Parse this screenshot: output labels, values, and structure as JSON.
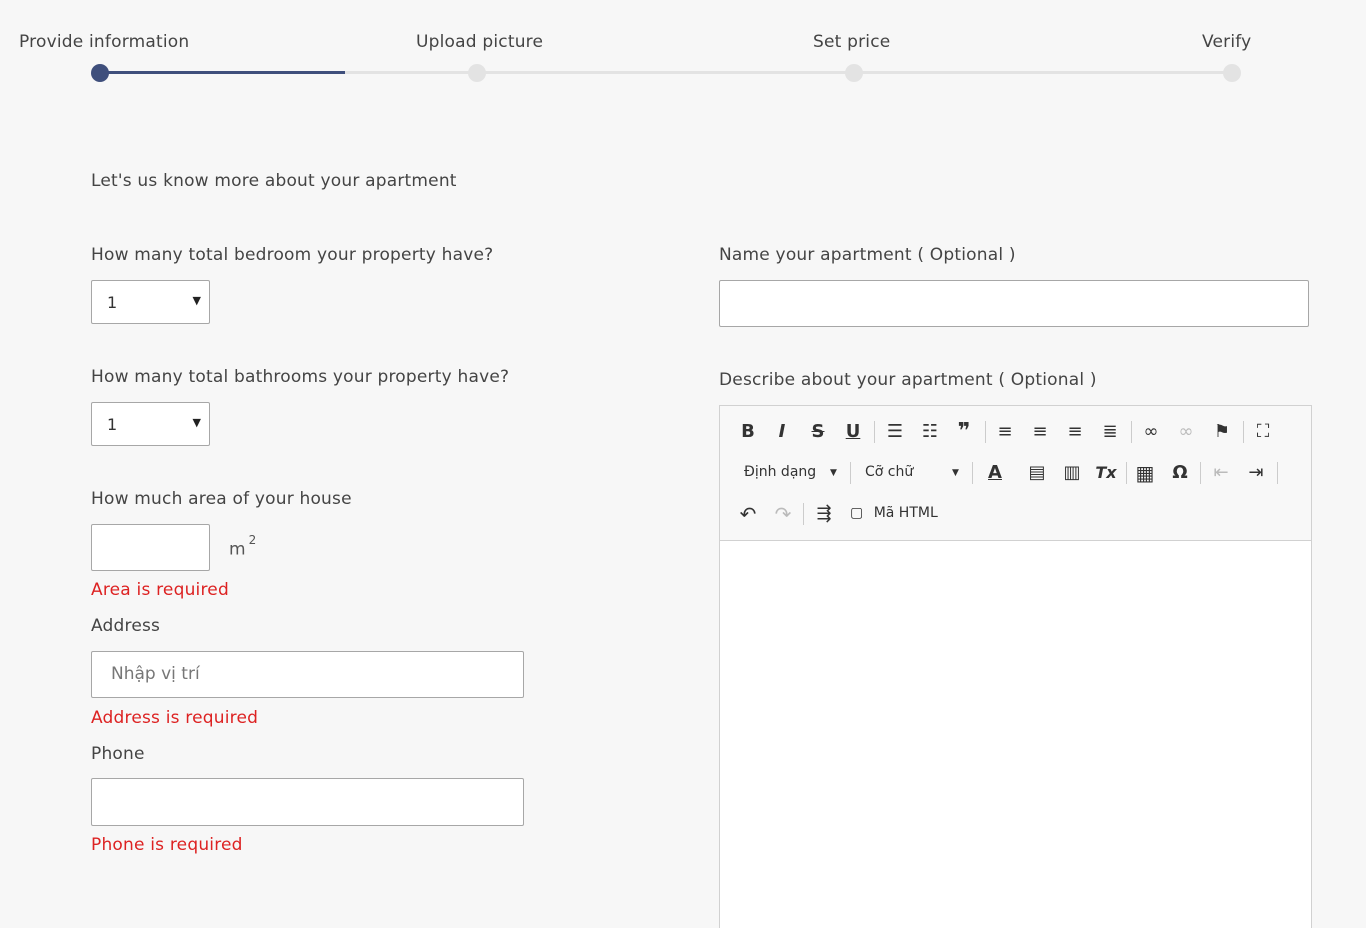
{
  "stepper": {
    "steps": [
      "Provide information",
      "Upload picture",
      "Set price",
      "Verify"
    ]
  },
  "form": {
    "intro": "Let's us know more about your apartment",
    "bedrooms": {
      "label": "How many total bedroom your property have?",
      "value": "1"
    },
    "bathrooms": {
      "label": "How many total bathrooms your property have?",
      "value": "1"
    },
    "area": {
      "label": "How much area of your house",
      "value": "",
      "unit": "m",
      "unit_sup": "2",
      "error": "Area is required"
    },
    "address": {
      "label": "Address",
      "placeholder": "Nhập vị trí",
      "error": "Address is required"
    },
    "phone": {
      "label": "Phone",
      "value": "",
      "error": "Phone is required"
    },
    "name": {
      "label": "Name your apartment ( Optional )",
      "value": ""
    },
    "description": {
      "label": "Describe about your apartment ( Optional )"
    }
  },
  "editor": {
    "format_combo": "Định dạng",
    "font_size_combo": "Cỡ chữ",
    "html_button": "Mã HTML",
    "icons": {
      "bold": "B",
      "italic": "I",
      "strike": "S",
      "underline": "U",
      "bullets": "☰",
      "numbered": "☷",
      "quote": "❞",
      "align_left": "≡",
      "align_center": "≡",
      "align_right": "≡",
      "justify": "≣",
      "link": "∞",
      "unlink": "∞",
      "flag": "⚑",
      "maximize": "⛶",
      "text_color": "A",
      "paste_text": "▤",
      "paste_word": "▥",
      "remove_format": "Tx",
      "table": "▦",
      "special_char": "Ω",
      "outdent": "⇤",
      "indent": "⇥",
      "undo": "↶",
      "redo": "↷",
      "blockquote_indent": "⇶",
      "source_icon": "▢"
    }
  },
  "colors": {
    "accent": "#3f4f7c",
    "error": "#dd2222",
    "track": "#e3e3e3"
  }
}
